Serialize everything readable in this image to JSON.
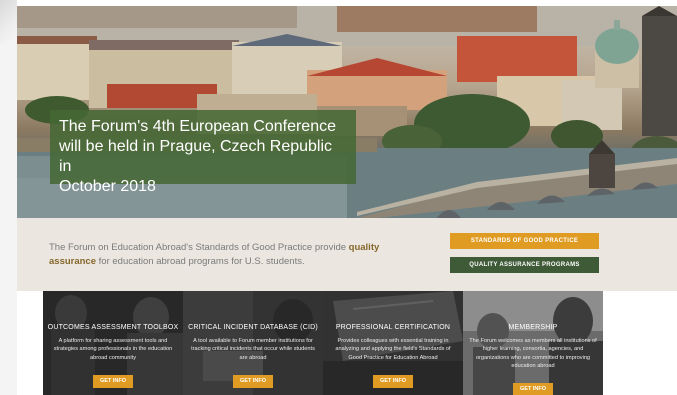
{
  "hero": {
    "caption_lines": [
      "The Forum's 4th European Conference",
      "will be held in Prague, Czech Republic in",
      "October 2018"
    ]
  },
  "intro": {
    "text_before": "The Forum on Education Abroad's Standards of Good Practice provide ",
    "highlight_1": "quality",
    "highlight_2": "assurance",
    "text_after": " for education abroad programs for U.S. students."
  },
  "buttons": {
    "standards": "STANDARDS OF GOOD PRACTICE",
    "assurance": "QUALITY ASSURANCE PROGRAMS"
  },
  "cards": [
    {
      "title": "OUTCOMES ASSESSMENT TOOLBOX",
      "description": "A platform for sharing assessment tools and strategies among professionals in the education abroad community",
      "button": "GET INFO"
    },
    {
      "title": "CRITICAL INCIDENT DATABASE (CID)",
      "description": "A tool available to Forum member institutions for tracking critical incidents that occur while students are abroad",
      "button": "GET INFO"
    },
    {
      "title": "PROFESSIONAL CERTIFICATION",
      "description": "Provides colleagues with essential training in analyzing and applying the field's Standards of Good Practice for Education Abroad",
      "button": "GET INFO"
    },
    {
      "title": "MEMBERSHIP",
      "description": "The Forum welcomes as members all institutions of higher learning, consortia, agencies, and organizations who are committed to improving education abroad",
      "button": "GET INFO"
    }
  ],
  "colors": {
    "caption_bg": "#456834",
    "accent_orange": "#e09b22",
    "accent_green": "#3f5a37",
    "band_bg": "#ebe7e0",
    "highlight_text": "#85672b"
  }
}
